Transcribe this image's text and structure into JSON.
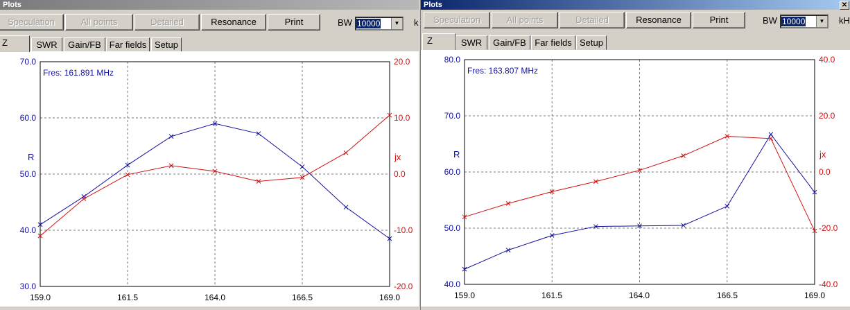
{
  "colors": {
    "blue": "#1010a0",
    "red": "#d01010",
    "grid": "#7a7a7a"
  },
  "left": {
    "title": "Plots",
    "toolbar": {
      "speculation": "Speculation",
      "all_points": "All points",
      "detailed": "Detailed",
      "resonance": "Resonance",
      "print": "Print",
      "bw_label": "BW",
      "bw_value": "10000",
      "unit": "kHz"
    },
    "tabs": [
      "Z",
      "SWR",
      "Gain/FB",
      "Far fields",
      "Setup"
    ],
    "chart": {
      "fres": "Fres: 161.891 MHz",
      "ylabel_left": "R",
      "ylabel_right": "jx",
      "xticks": [
        "159.0",
        "161.5",
        "164.0",
        "166.5",
        "169.0"
      ],
      "yticks_left": [
        "70.0",
        "60.0",
        "50.0",
        "40.0",
        "30.0"
      ],
      "yticks_right": [
        "20.0",
        "10.0",
        "0.0",
        "-10.0",
        "-20.0"
      ]
    }
  },
  "right": {
    "title": "Plots",
    "toolbar": {
      "speculation": "Speculation",
      "all_points": "All points",
      "detailed": "Detailed",
      "resonance": "Resonance",
      "print": "Print",
      "bw_label": "BW",
      "bw_value": "10000",
      "unit": "kHz"
    },
    "tabs": [
      "Z",
      "SWR",
      "Gain/FB",
      "Far fields",
      "Setup"
    ],
    "chart": {
      "fres": "Fres: 163.807 MHz",
      "ylabel_left": "R",
      "ylabel_right": "jx",
      "xticks": [
        "159.0",
        "161.5",
        "164.0",
        "166.5",
        "169.0"
      ],
      "yticks_left": [
        "80.0",
        "70.0",
        "60.0",
        "50.0",
        "40.0"
      ],
      "yticks_right": [
        "40.0",
        "20.0",
        "0.0",
        "-20.0",
        "-40.0"
      ]
    }
  },
  "chart_data": [
    {
      "type": "line",
      "x": [
        159.0,
        160.25,
        161.5,
        162.75,
        164.0,
        165.25,
        166.5,
        167.75,
        169.0
      ],
      "xlim": [
        159.0,
        169.0
      ],
      "ylim": [
        30.0,
        70.0
      ],
      "y2lim": [
        -20.0,
        20.0
      ],
      "grid": true,
      "series": [
        {
          "name": "R",
          "axis": "left",
          "values": [
            41.0,
            46.0,
            51.6,
            56.7,
            59.0,
            57.2,
            51.3,
            44.1,
            38.5
          ]
        },
        {
          "name": "jx",
          "axis": "right",
          "values": [
            -11.0,
            -4.4,
            -0.1,
            1.5,
            0.5,
            -1.3,
            -0.6,
            3.8,
            10.5
          ]
        }
      ]
    },
    {
      "type": "line",
      "x": [
        159.0,
        160.25,
        161.5,
        162.75,
        164.0,
        165.25,
        166.5,
        167.75,
        169.0
      ],
      "xlim": [
        159.0,
        169.0
      ],
      "ylim": [
        40.0,
        80.0
      ],
      "y2lim": [
        -40.0,
        40.0
      ],
      "grid": true,
      "series": [
        {
          "name": "R",
          "axis": "left",
          "values": [
            42.7,
            46.1,
            48.7,
            50.3,
            50.4,
            50.5,
            53.9,
            66.7,
            56.4
          ]
        },
        {
          "name": "jx",
          "axis": "right",
          "values": [
            -16.0,
            -11.2,
            -7.0,
            -3.4,
            0.6,
            5.8,
            12.7,
            11.9,
            -21.0
          ]
        }
      ]
    }
  ]
}
